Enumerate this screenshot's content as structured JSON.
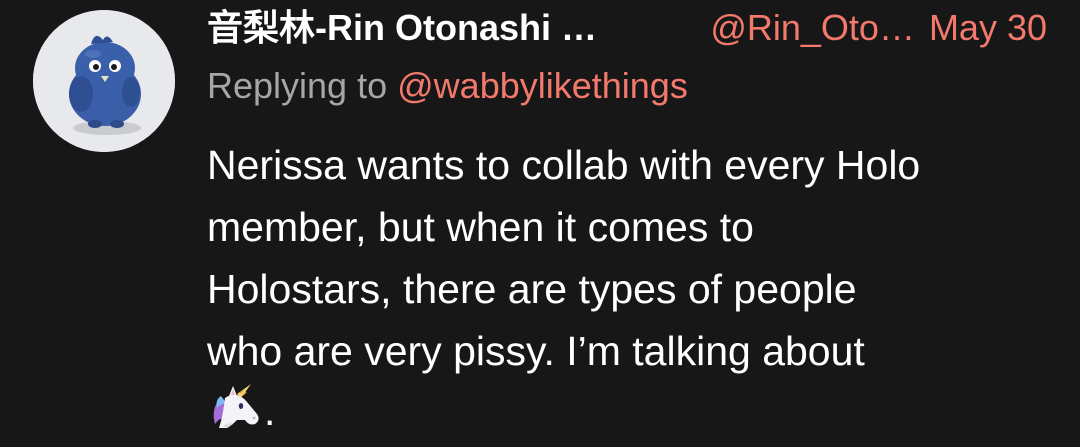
{
  "tweet": {
    "avatar_icon": "blue-bird-plush-avatar",
    "display_name": "音梨林-Rin Otonashi …",
    "handle": "@Rin_Oto…",
    "date": "May 30",
    "reply_prefix": "Replying to",
    "reply_to": "@wabbylikethings",
    "text_lines": [
      "Nerissa wants to collab with every Holo",
      "member, but when it comes to",
      "Holostars, there are types of people",
      "who are very pissy. I’m talking about"
    ],
    "emoji": "unicorn-icon",
    "trailing_punct": "."
  },
  "colors": {
    "background": "#171717",
    "accent": "#f2796c",
    "muted": "#a6a6a6",
    "text": "#ffffff"
  }
}
